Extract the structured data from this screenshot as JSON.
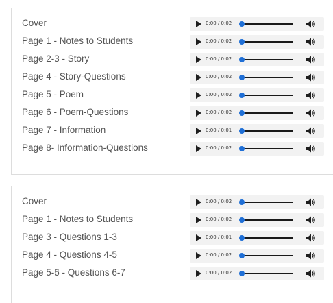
{
  "colors": {
    "accent": "#1f6fd6",
    "title_text": "#555555",
    "player_bg": "#f2f2f2"
  },
  "icons": {
    "play": "play-icon",
    "volume": "volume-icon"
  },
  "groups": [
    {
      "tracks": [
        {
          "title": "Cover",
          "time": "0:00 / 0:02",
          "progress": 0
        },
        {
          "title": "Page 1 - Notes to Students",
          "time": "0:00 / 0:02",
          "progress": 0
        },
        {
          "title": "Page 2-3 - Story",
          "time": "0:00 / 0:02",
          "progress": 0
        },
        {
          "title": "Page 4 - Story-Questions",
          "time": "0:00 / 0:02",
          "progress": 0
        },
        {
          "title": "Page 5 - Poem",
          "time": "0:00 / 0:02",
          "progress": 0
        },
        {
          "title": "Page 6 - Poem-Questions",
          "time": "0:00 / 0:02",
          "progress": 0
        },
        {
          "title": "Page 7 - Information",
          "time": "0:00 / 0:01",
          "progress": 0
        },
        {
          "title": "Page 8- Information-Questions",
          "time": "0:00 / 0:02",
          "progress": 0
        }
      ]
    },
    {
      "tracks": [
        {
          "title": "Cover",
          "time": "0:00 / 0:02",
          "progress": 0
        },
        {
          "title": "Page 1 - Notes to Students",
          "time": "0:00 / 0:02",
          "progress": 0
        },
        {
          "title": "Page 3 - Questions 1-3",
          "time": "0:00 / 0:01",
          "progress": 0
        },
        {
          "title": "Page 4 - Questions 4-5",
          "time": "0:00 / 0:02",
          "progress": 0
        },
        {
          "title": "Page 5-6 - Questions 6-7",
          "time": "0:00 / 0:02",
          "progress": 0
        }
      ]
    }
  ]
}
